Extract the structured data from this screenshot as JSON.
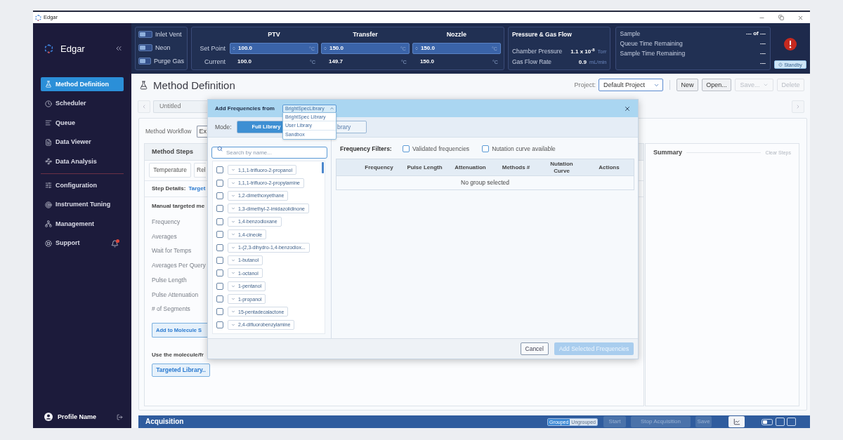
{
  "window": {
    "title": "Edgar"
  },
  "sidebar": {
    "brand": "Edgar",
    "sections": [
      {
        "items": [
          {
            "label": "Method Definition",
            "selected": true
          },
          {
            "label": "Scheduler",
            "selected": false
          },
          {
            "label": "Queue",
            "selected": false
          },
          {
            "label": "Data Viewer",
            "selected": false
          },
          {
            "label": "Data Analysis",
            "selected": false
          }
        ]
      },
      {
        "items": [
          {
            "label": "Configuration",
            "selected": false
          },
          {
            "label": "Instrument Tuning",
            "selected": false
          },
          {
            "label": "Management",
            "selected": false
          },
          {
            "label": "Support",
            "selected": false
          }
        ]
      }
    ],
    "profile": "Profile Name"
  },
  "header": {
    "toggles": [
      {
        "label": "Inlet Vent",
        "on": false
      },
      {
        "label": "Neon",
        "on": false
      },
      {
        "label": "Purge Gas",
        "on": false
      }
    ],
    "temperatures": {
      "columns": [
        "PTV",
        "Transfer",
        "Nozzle"
      ],
      "rows": [
        {
          "label": "Set Point",
          "kind": "input",
          "cells": [
            {
              "value": "100.0",
              "unit": "°C"
            },
            {
              "value": "150.0",
              "unit": "°C"
            },
            {
              "value": "150.0",
              "unit": "°C"
            }
          ]
        },
        {
          "label": "Current",
          "kind": "reading",
          "cells": [
            {
              "value": "100.0",
              "unit": "°C"
            },
            {
              "value": "149.7",
              "unit": "°C"
            },
            {
              "value": "150.0",
              "unit": "°C"
            }
          ]
        }
      ]
    },
    "pressure": {
      "title": "Pressure & Gas Flow",
      "rows": [
        {
          "label": "Chamber Pressure",
          "value": "1.1 x 10$^{-8}$",
          "unit": "Torr"
        },
        {
          "label": "Gas Flow Rate",
          "value": "0.9",
          "unit": "mL/min"
        }
      ]
    },
    "progress": {
      "rows": [
        {
          "label": "Sample",
          "value": "--- of ---"
        },
        {
          "label": "Queue Time Remaining",
          "value": "---"
        },
        {
          "label": "Sample Time Remaining",
          "value": "---"
        },
        {
          "value": "---"
        }
      ]
    },
    "status_button": "Standby"
  },
  "main": {
    "title": "Method Definition",
    "project": {
      "label": "Project:",
      "value": "Default Project"
    },
    "actions": [
      {
        "label": "New",
        "kind": "button",
        "disabled": false
      },
      {
        "label": "Open...",
        "kind": "button",
        "disabled": false
      },
      {
        "label": "Save...",
        "kind": "menu",
        "disabled": true
      },
      {
        "label": "Delete",
        "kind": "button",
        "disabled": true
      }
    ],
    "method_name": "Untitled",
    "workflow": {
      "label": "Method Workflow",
      "value": "Ex"
    },
    "steps": {
      "title": "Method Steps",
      "tabs": [
        "Temperature",
        "Rel"
      ],
      "details_label": "Step Details:",
      "details_value": "Target",
      "section_title": "Manual targeted me",
      "fields": [
        "Frequency",
        "Averages",
        "Wait for Temps",
        "Averages Per Query",
        "Pulse Length",
        "Pulse Attenuation",
        "# of Segments"
      ],
      "add_button": "Add to Molecule S",
      "library_hint": "Use the molecule/fr",
      "library_button": "Targeted Library.."
    },
    "summary": {
      "title": "Summary",
      "clear": "Clear Steps"
    }
  },
  "acquisition": {
    "title": "Acquisition",
    "view_modes": [
      {
        "label": "Grouped",
        "selected": true
      },
      {
        "label": "Ungrouped",
        "selected": false
      }
    ],
    "buttons": [
      {
        "label": "Start",
        "disabled": true
      },
      {
        "label": "Stop Acquisition",
        "disabled": true
      },
      {
        "label": "Save",
        "disabled": true
      }
    ]
  },
  "dialog": {
    "title": "Add Frequencies from",
    "source": {
      "value": "BrightSpecLibrary",
      "expanded": true,
      "options": [
        "BrightSpec Library",
        "User Library",
        "Sandbox"
      ]
    },
    "mode_label": "Mode:",
    "modes": [
      {
        "label": "Full Library",
        "selected": true
      },
      {
        "label": "brary",
        "selected": false
      }
    ],
    "search": {
      "placeholder": "Search by name..."
    },
    "molecules": [
      {
        "name": "1,1,1-trifluoro-2-propanol",
        "checked": false
      },
      {
        "name": "1,1,1-trifluoro-2-propylamine",
        "checked": false
      },
      {
        "name": "1,2-dimethoxyethane",
        "checked": false
      },
      {
        "name": "1,3-dimethyl-2-imidazolidinone",
        "checked": false
      },
      {
        "name": "1,4-benzodioxane",
        "checked": false
      },
      {
        "name": "1,4-cineole",
        "checked": false
      },
      {
        "name": "1-(2,3-dihydro-1,4-benzodiox...",
        "checked": false
      },
      {
        "name": "1-butanol",
        "checked": false
      },
      {
        "name": "1-octanol",
        "checked": false
      },
      {
        "name": "1-pentanol",
        "checked": false
      },
      {
        "name": "1-propanol",
        "checked": false
      },
      {
        "name": "15-pentadecalactone",
        "checked": false
      },
      {
        "name": "2,4-difluorobenzylamine",
        "checked": false
      }
    ],
    "filters_label": "Frequency Filters:",
    "filters": [
      {
        "label": "Validated frequencies",
        "checked": false
      },
      {
        "label": "Nutation curve available",
        "checked": false
      }
    ],
    "table": {
      "columns": [
        "Frequency",
        "Pulse Length",
        "Attenuation",
        "Methods #",
        "Nutation Curve",
        "Actions"
      ],
      "empty": "No group selected"
    },
    "buttons": [
      {
        "label": "Cancel",
        "disabled": false
      },
      {
        "label": "Add Selected Frequencies",
        "disabled": true
      }
    ]
  }
}
